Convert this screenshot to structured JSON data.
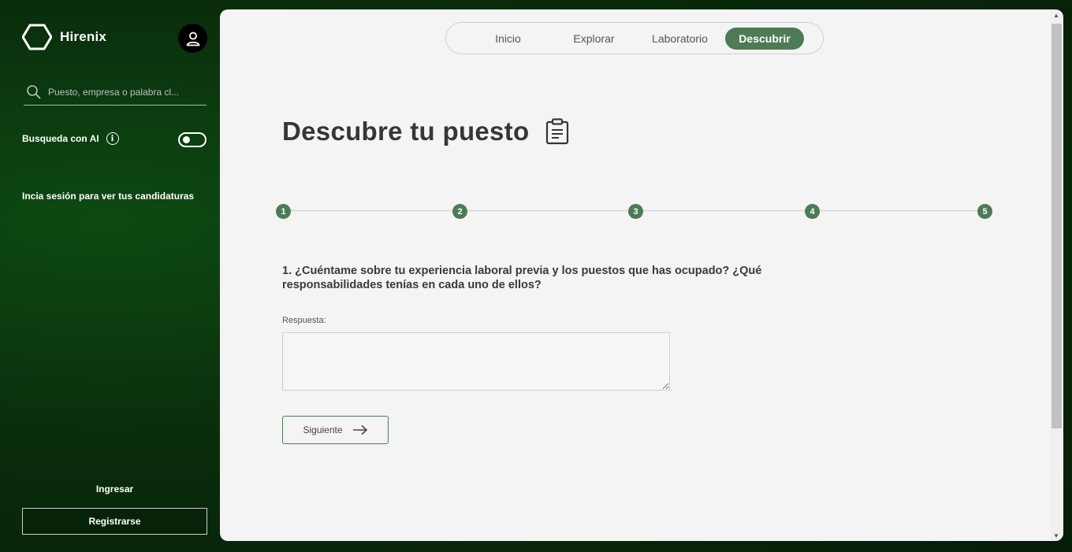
{
  "brand": {
    "name": "Hirenix"
  },
  "sidebar": {
    "search_placeholder": "Puesto, empresa o palabra cl...",
    "ai_search_label": "Busqueda con AI",
    "ai_toggle_on": false,
    "login_hint": "Incia sesión para ver tus candidaturas",
    "login_label": "Ingresar",
    "register_label": "Registrarse"
  },
  "nav": {
    "tabs": [
      {
        "label": "Inicio",
        "active": false
      },
      {
        "label": "Explorar",
        "active": false
      },
      {
        "label": "Laboratorio",
        "active": false
      },
      {
        "label": "Descubrir",
        "active": true
      }
    ]
  },
  "page": {
    "title": "Descubre tu puesto",
    "steps": [
      "1",
      "2",
      "3",
      "4",
      "5"
    ],
    "current_step": 1,
    "question": "1. ¿Cuéntame sobre tu experiencia laboral previa y los puestos que has ocupado? ¿Qué responsabilidades tenías en cada uno de ellos?",
    "answer_label": "Respuesta:",
    "answer_value": "",
    "next_label": "Siguiente"
  },
  "colors": {
    "accent": "#4e7a55",
    "sidebar_bg": "#0a2e0c",
    "panel_bg": "#f4f4f4"
  }
}
